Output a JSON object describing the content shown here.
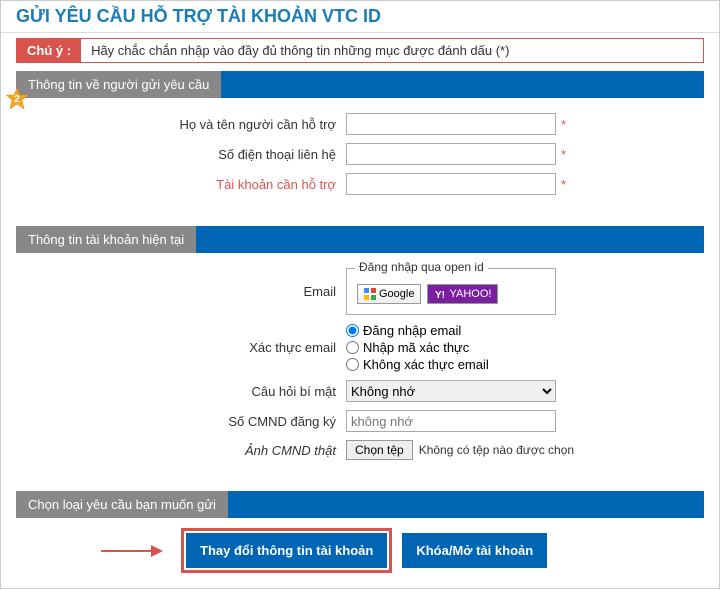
{
  "page_title": "GỬI YÊU CẦU HỖ TRỢ TÀI KHOẢN VTC ID",
  "notice": {
    "label": "Chú ý :",
    "text": "Hãy chắc chắn nhập vào đầy đủ thông tin những mục được đánh dấu (*)"
  },
  "section1": {
    "title": "Thông tin về người gửi yêu cầu",
    "fullname_label": "Họ và tên người cần hỗ trợ",
    "phone_label": "Số điện thoại liên hệ",
    "account_label": "Tài khoản cần hỗ trợ",
    "asterisk": "*"
  },
  "section2": {
    "title": "Thông tin tài khoản hiện tại",
    "email_label": "Email",
    "openid_legend": "Đăng nhập qua open id",
    "google_label": "Google",
    "yahoo_label": "YAHOO!",
    "verify_label": "Xác thực email",
    "radio_login": "Đăng nhập email",
    "radio_code": "Nhập mã xác thực",
    "radio_none": "Không xác thực email",
    "question_label": "Câu hỏi bí mật",
    "question_value": "Không nhớ",
    "cmnd_label": "Số CMND đăng ký",
    "cmnd_placeholder": "không nhớ",
    "photo_label": "Ảnh CMND thật",
    "file_btn": "Chọn tệp",
    "file_none": "Không có tệp nào được chọn"
  },
  "section3": {
    "title": "Chọn loại yêu cầu bạn muốn gửi",
    "btn_change": "Thay đổi thông tin tài khoản",
    "btn_lock": "Khóa/Mở tài khoản"
  },
  "star_badge_number": "2"
}
